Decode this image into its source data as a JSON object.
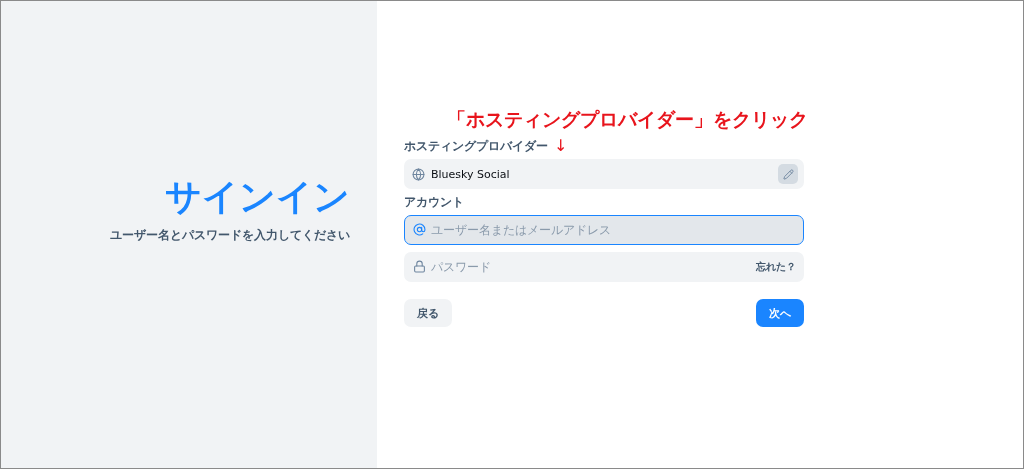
{
  "intro": {
    "title": "サインイン",
    "subtitle": "ユーザー名とパスワードを入力してください"
  },
  "annotation": {
    "text": "「ホスティングプロバイダー」をクリック",
    "arrow": "↓"
  },
  "hosting": {
    "label": "ホスティングプロバイダー",
    "value": "Bluesky Social"
  },
  "account": {
    "label": "アカウント",
    "username": {
      "placeholder": "ユーザー名またはメールアドレス",
      "focused": true
    },
    "password": {
      "placeholder": "パスワード",
      "focused": false,
      "forgot": "忘れた？"
    }
  },
  "buttons": [
    {
      "label": "戻る",
      "kind": "secondary"
    },
    {
      "label": "次へ",
      "kind": "primary"
    }
  ]
}
